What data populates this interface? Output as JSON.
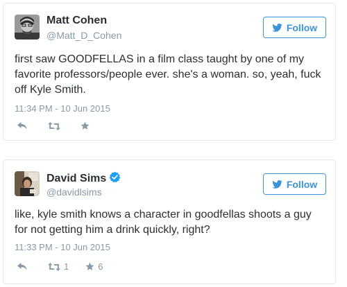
{
  "colors": {
    "accent": "#3b94d9",
    "verified": "#1da1f2",
    "muted": "#8899a6",
    "text": "#292f33",
    "border": "#e1e8ed"
  },
  "tweets": [
    {
      "display_name": "Matt Cohen",
      "handle": "@Matt_D_Cohen",
      "verified": false,
      "follow_label": "Follow",
      "text": "first saw GOODFELLAS in a film class taught by one of my favorite professors/people ever. she's a woman. so, yeah, fuck off Kyle Smith.",
      "timestamp": "11:34 PM - 10 Jun 2015",
      "retweet_count": "",
      "favorite_count": "",
      "icons": [
        "reply-icon",
        "retweet-icon",
        "favorite-icon",
        "twitter-bird-icon"
      ]
    },
    {
      "display_name": "David Sims",
      "handle": "@davidlsims",
      "verified": true,
      "follow_label": "Follow",
      "text": "like, kyle smith knows a character in goodfellas shoots a guy for not getting him a drink quickly, right?",
      "timestamp": "11:33 PM - 10 Jun 2015",
      "retweet_count": "1",
      "favorite_count": "6",
      "icons": [
        "reply-icon",
        "retweet-icon",
        "favorite-icon",
        "twitter-bird-icon",
        "verified-badge-icon"
      ]
    }
  ]
}
